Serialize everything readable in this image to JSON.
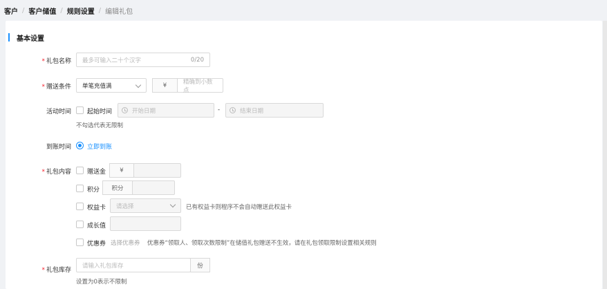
{
  "breadcrumb": [
    "客户",
    "客户储值",
    "规则设置",
    "编辑礼包"
  ],
  "section_title": "基本设置",
  "gift_name": {
    "label": "礼包名称",
    "placeholder": "最多可输入二十个汉字",
    "counter": "0/20"
  },
  "condition": {
    "label": "赠送条件",
    "select_value": "单笔充值满",
    "currency": "¥",
    "amount_placeholder": "精确到小数点"
  },
  "activity_time": {
    "label": "活动时间",
    "checkbox_label": "起始时间",
    "start_placeholder": "开始日期",
    "separator": "-",
    "end_placeholder": "结束日期",
    "hint": "不勾选代表无限制"
  },
  "arrival_time": {
    "label": "到账时间",
    "option": "立即到账"
  },
  "content": {
    "label": "礼包内容",
    "gift_money": {
      "label": "赠送金",
      "currency": "¥"
    },
    "points": {
      "label": "积分",
      "addon": "积分"
    },
    "benefit_card": {
      "label": "权益卡",
      "placeholder": "请选择",
      "hint": "已有权益卡则程序不会自动赠送此权益卡"
    },
    "growth": {
      "label": "成长值"
    },
    "coupon": {
      "label": "优惠券",
      "select_link": "选择优惠券",
      "hint": "优惠券“领取人、领取次数限制”在储值礼包赠送不生效，请在礼包领取限制设置相关规则"
    }
  },
  "stock": {
    "label": "礼包库存",
    "placeholder": "请输入礼包库存",
    "unit": "份",
    "hint": "设置为0表示不限制"
  }
}
